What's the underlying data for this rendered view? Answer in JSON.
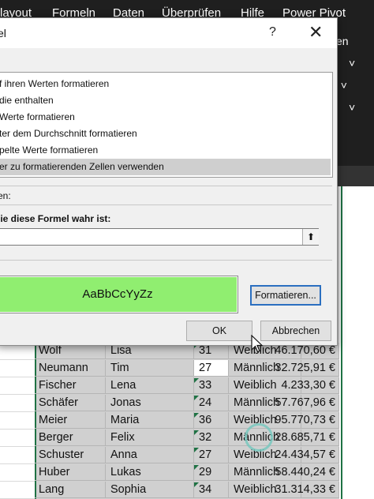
{
  "ribbon": {
    "tabs": [
      "layout",
      "Formeln",
      "Daten",
      "Überprüfen",
      "Hilfe",
      "Power Pivot"
    ],
    "right_fragments": [
      "en",
      "˅",
      "t ˅",
      "˅"
    ]
  },
  "dialog": {
    "title": "el",
    "help_label": "?",
    "close_label": "✕",
    "rule_types": [
      "f ihren Werten formatieren",
      "die enthalten",
      "Werte formatieren",
      "ter dem Durchschnitt formatieren",
      "pelte Werte formatieren",
      "er zu formatierenden Zellen verwenden"
    ],
    "selected_rule_index": 5,
    "section_label": "en:",
    "formula_label": "lie diese Formel wahr ist:",
    "formula_value": "",
    "collapse_icon": "⬆",
    "preview_text": "AaBbCcYyZz",
    "preview_color": "#90ee70",
    "format_button": "Formatieren...",
    "ok_button": "OK",
    "cancel_button": "Abbrechen"
  },
  "sheet": {
    "rows": [
      {
        "nachname": "Wolf",
        "vorname": "Lisa",
        "alter": "31",
        "geschlecht": "Weiblich",
        "gehalt": "46.170,60 €"
      },
      {
        "nachname": "Neumann",
        "vorname": "Tim",
        "alter": "27",
        "geschlecht": "Männlich",
        "gehalt": "32.725,91 €"
      },
      {
        "nachname": "Fischer",
        "vorname": "Lena",
        "alter": "33",
        "geschlecht": "Weiblich",
        "gehalt": "4.233,30 €"
      },
      {
        "nachname": "Schäfer",
        "vorname": "Jonas",
        "alter": "24",
        "geschlecht": "Männlich",
        "gehalt": "57.767,96 €"
      },
      {
        "nachname": "Meier",
        "vorname": "Maria",
        "alter": "36",
        "geschlecht": "Weiblich",
        "gehalt": "95.770,73 €"
      },
      {
        "nachname": "Berger",
        "vorname": "Felix",
        "alter": "32",
        "geschlecht": "Männlich",
        "gehalt": "28.685,71 €"
      },
      {
        "nachname": "Schuster",
        "vorname": "Anna",
        "alter": "27",
        "geschlecht": "Weiblich",
        "gehalt": "24.434,57 €"
      },
      {
        "nachname": "Huber",
        "vorname": "Lukas",
        "alter": "29",
        "geschlecht": "Männlich",
        "gehalt": "58.440,24 €"
      },
      {
        "nachname": "Lang",
        "vorname": "Sophia",
        "alter": "34",
        "geschlecht": "Weiblich",
        "gehalt": "31.314,33 €"
      }
    ],
    "active_row_index": 1,
    "accent_color": "#1f7244"
  }
}
